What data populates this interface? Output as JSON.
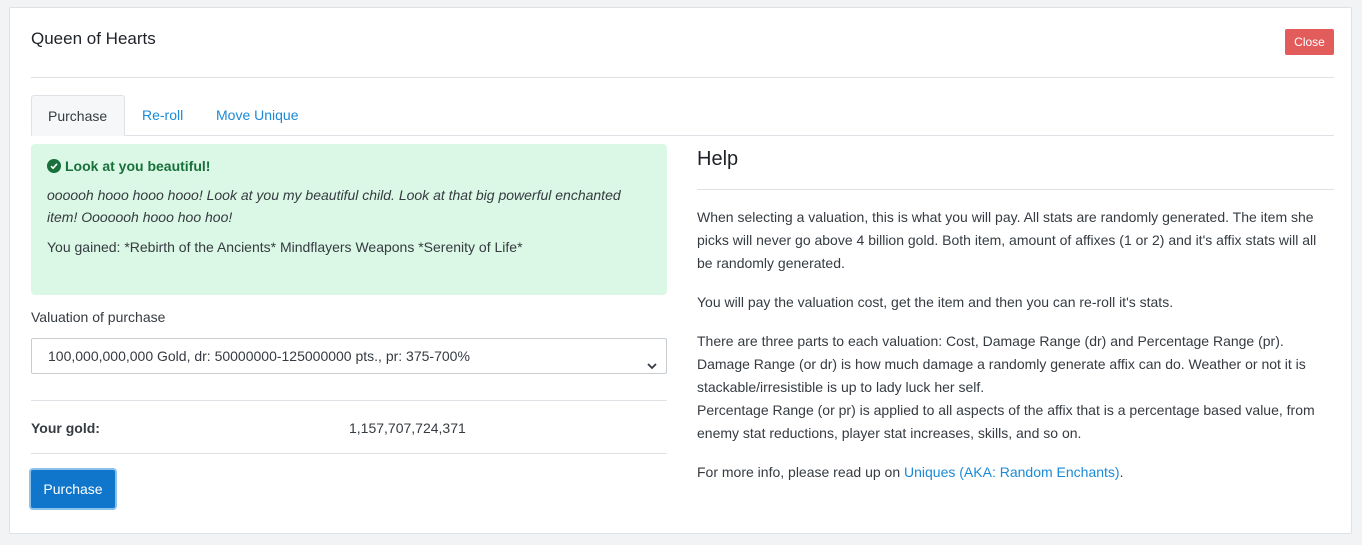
{
  "modal": {
    "title": "Queen of Hearts",
    "close_label": "Close"
  },
  "tabs": [
    {
      "label": "Purchase",
      "active": true
    },
    {
      "label": "Re-roll",
      "active": false
    },
    {
      "label": "Move Unique",
      "active": false
    }
  ],
  "alert": {
    "icon": "check-circle-icon",
    "title": "Look at you beautiful!",
    "message": "oooooh hooo hooo hooo! Look at you my beautiful child. Look at that big powerful enchanted item! Ooooooh hooo hoo hoo!",
    "gained": "You gained: *Rebirth of the Ancients* Mindflayers Weapons *Serenity of Life*"
  },
  "form": {
    "valuation_label": "Valuation of purchase",
    "valuation_selected": "100,000,000,000 Gold, dr: 50000000-125000000 pts., pr: 375-700%",
    "gold_label": "Your gold:",
    "gold_value": "1,157,707,724,371",
    "purchase_label": "Purchase"
  },
  "help": {
    "title": "Help",
    "p1": "When selecting a valuation, this is what you will pay. All stats are randomly generated. The item she picks will never go above 4 billion gold. Both item, amount of affixes (1 or 2) and it's affix stats will all be randomly generated.",
    "p2": "You will pay the valuation cost, get the item and then you can re-roll it's stats.",
    "p3a": "There are three parts to each valuation: Cost, Damage Range (dr) and Percentage Range (pr).",
    "p3b": "Damage Range (or dr) is how much damage a randomly generate affix can do. Weather or not it is stackable/irresistible is up to lady luck her self.",
    "p3c": "Percentage Range (or pr) is applied to all aspects of the affix that is a percentage based value, from enemy stat reductions, player stat increases, skills, and so on.",
    "p4_prefix": "For more info, please read up on ",
    "p4_link": "Uniques (AKA: Random Enchants)",
    "p4_suffix": "."
  },
  "colors": {
    "accent": "#0f76cc",
    "link": "#1a8ad6",
    "danger": "#e25c5c",
    "success_bg": "#dbf7e5",
    "success_text": "#18703a"
  }
}
